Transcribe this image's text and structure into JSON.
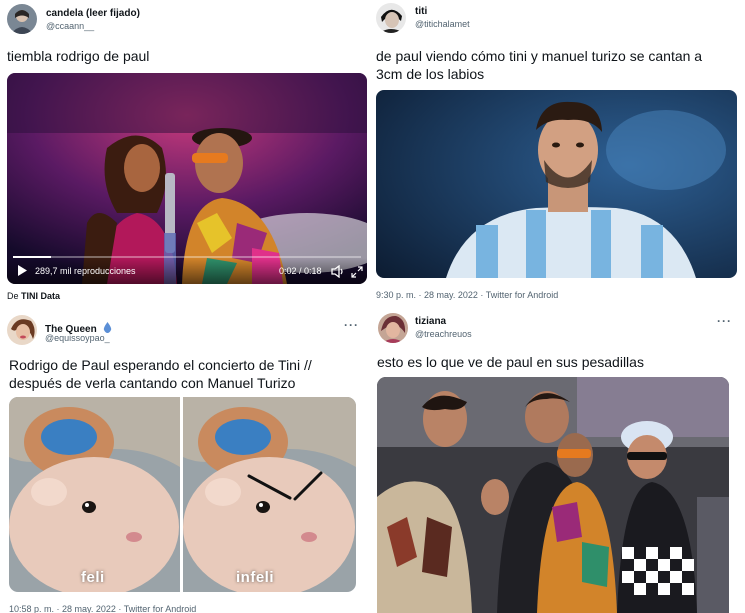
{
  "tweets": [
    {
      "name": "candela (leer fijado)",
      "handle": "@ccaann__",
      "text": "tiembla rodrigo de paul",
      "video": {
        "views": "289,7 mil reproducciones",
        "time": "0:02 / 0:18",
        "progress": 0.11
      },
      "source_prefix": "De",
      "source_name": "TINI Data"
    },
    {
      "name": "titi",
      "handle": "@titichalamet",
      "text_line1": "de paul viendo cómo tini y manuel turizo se cantan a",
      "text_line2": "3cm de los labios",
      "meta": "9:30 p. m. · 28 may. 2022 · Twitter for Android"
    },
    {
      "name": "The Queen",
      "name_icon": "water-drop-icon",
      "handle": "@equissoypao_",
      "more": "···",
      "text_line1": "Rodrigo de Paul esperando el concierto de Tini //",
      "text_line2": "después de verla cantando con Manuel Turizo",
      "label_left": "feli",
      "label_right": "infeli",
      "meta": "10:58 p. m. · 28 may. 2022 · Twitter for Android"
    },
    {
      "name": "tiziana",
      "handle": "@treachreuos",
      "more": "···",
      "text": "esto es lo que ve de paul en sus pesadillas"
    }
  ],
  "colors": {
    "text": "#0f1419",
    "secondary": "#536471",
    "divider": "#f2f2f2"
  }
}
